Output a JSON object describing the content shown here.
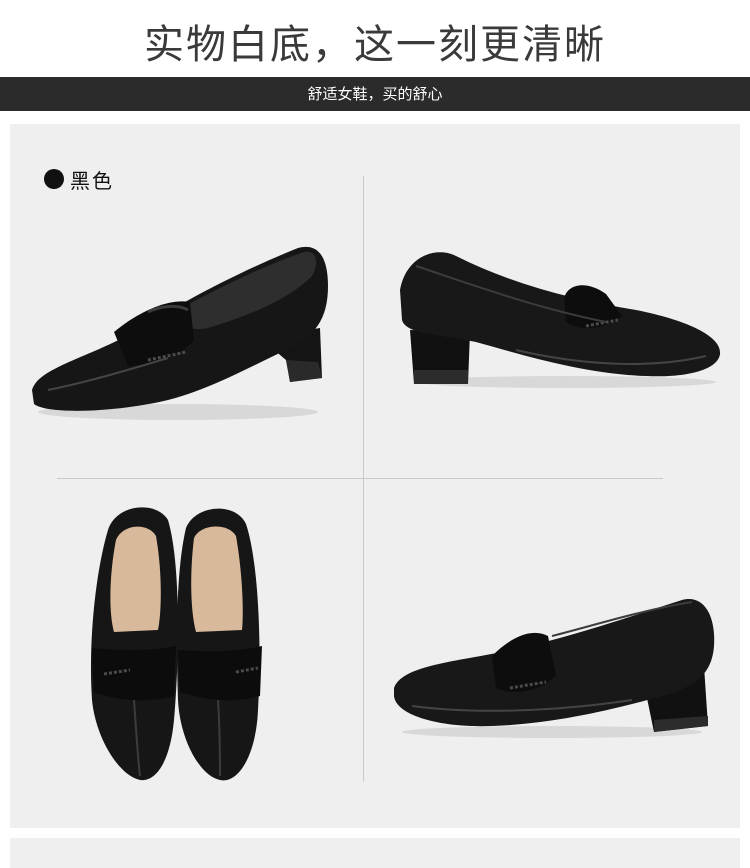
{
  "header": {
    "title": "实物白底，这一刻更清晰",
    "banner": "舒适女鞋，买的舒心"
  },
  "product": {
    "color_label": "黑色",
    "color_swatch": "#111111",
    "views": [
      {
        "name": "shoe-three-quarter-view"
      },
      {
        "name": "shoe-side-view"
      },
      {
        "name": "shoe-top-view-pair"
      },
      {
        "name": "shoe-side-view-alt"
      }
    ]
  },
  "colors": {
    "banner_bg": "#2b2b2b",
    "panel_bg": "#efefef",
    "divider": "#c9c9c9"
  }
}
